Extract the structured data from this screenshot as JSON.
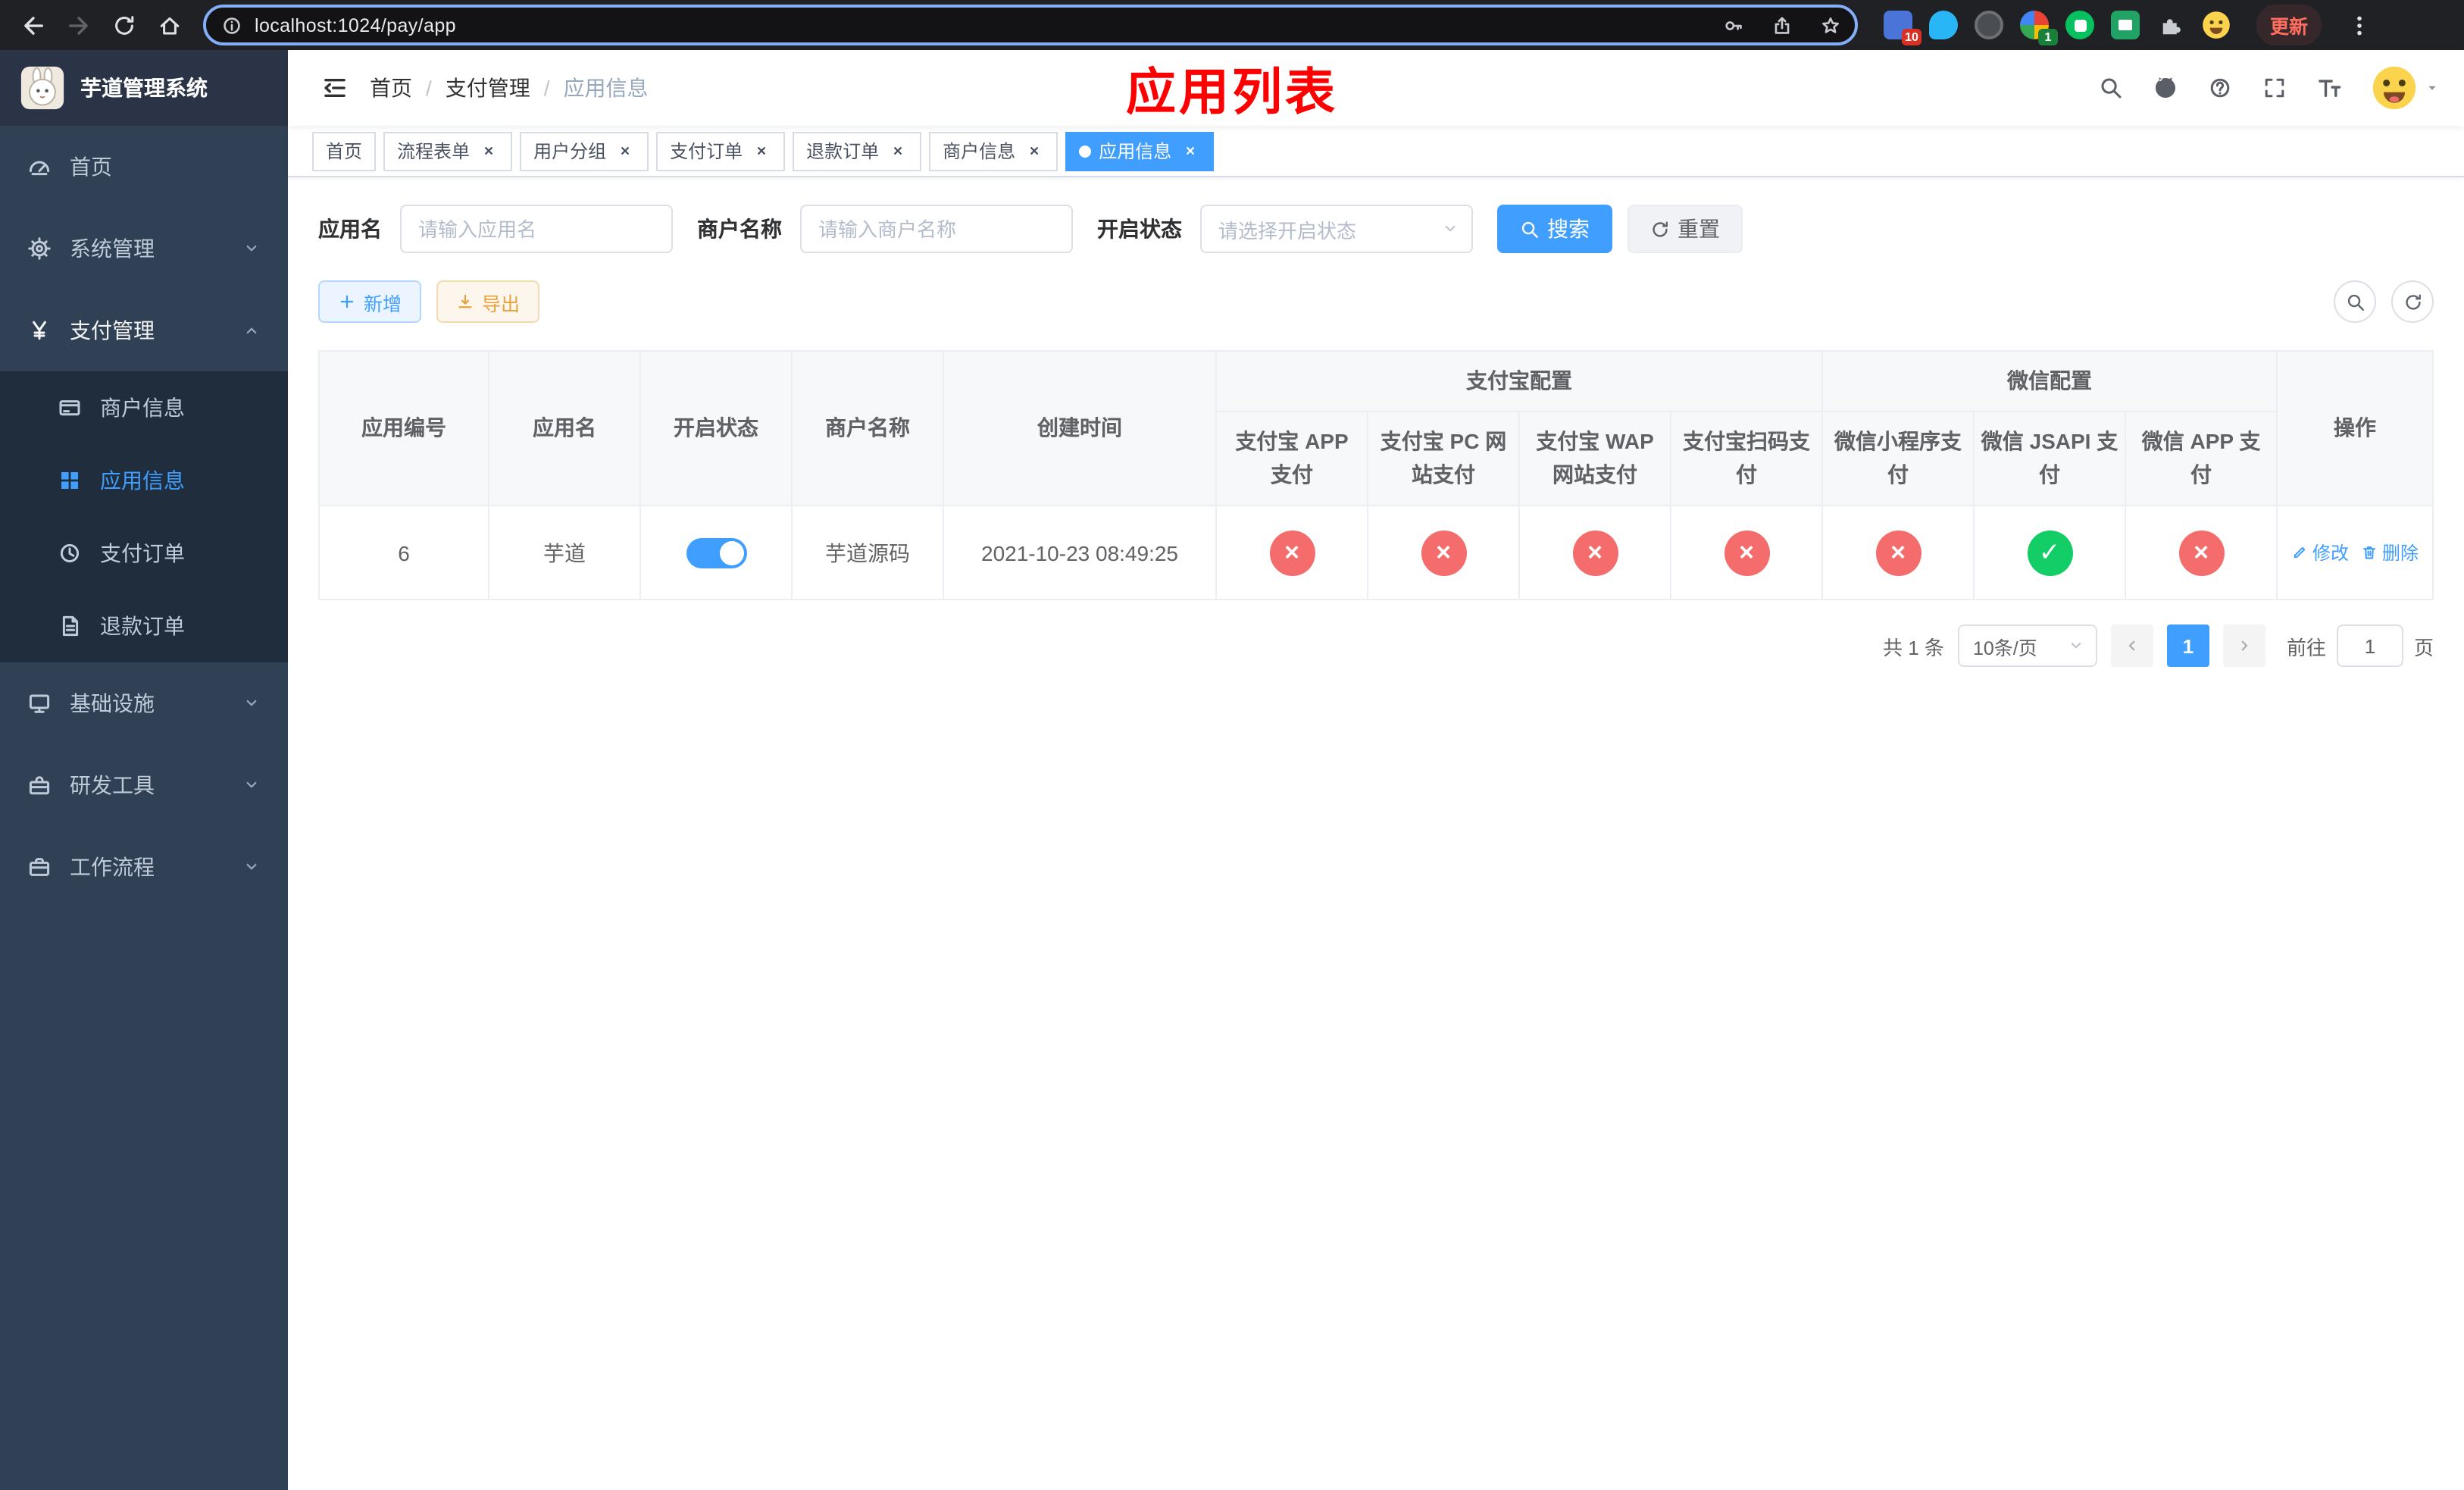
{
  "browser": {
    "url": "localhost:1024/pay/app",
    "update_label": "更新",
    "ext_badge_red": "10",
    "ext_badge_green": "1"
  },
  "sidebar": {
    "title": "芋道管理系统",
    "items": {
      "home": "首页",
      "system": "系统管理",
      "payment": "支付管理",
      "merchant_info": "商户信息",
      "app_info": "应用信息",
      "pay_order": "支付订单",
      "refund_order": "退款订单",
      "infra": "基础设施",
      "dev_tools": "研发工具",
      "workflow": "工作流程"
    }
  },
  "navbar": {
    "breadcrumb": {
      "home": "首页",
      "sep": "/",
      "section": "支付管理",
      "current": "应用信息"
    },
    "overlay_title": "应用列表"
  },
  "tabs": [
    {
      "label": "首页",
      "closable": false,
      "active": false
    },
    {
      "label": "流程表单",
      "closable": true,
      "active": false
    },
    {
      "label": "用户分组",
      "closable": true,
      "active": false
    },
    {
      "label": "支付订单",
      "closable": true,
      "active": false
    },
    {
      "label": "退款订单",
      "closable": true,
      "active": false
    },
    {
      "label": "商户信息",
      "closable": true,
      "active": false
    },
    {
      "label": "应用信息",
      "closable": true,
      "active": true
    }
  ],
  "filters": {
    "app_name": {
      "label": "应用名",
      "placeholder": "请输入应用名",
      "value": ""
    },
    "merchant_name": {
      "label": "商户名称",
      "placeholder": "请输入商户名称",
      "value": ""
    },
    "status": {
      "label": "开启状态",
      "placeholder": "请选择开启状态"
    },
    "search": "搜索",
    "reset": "重置"
  },
  "toolbar": {
    "add": "新增",
    "export": "导出"
  },
  "table": {
    "columns": {
      "app_id": "应用编号",
      "app_name": "应用名",
      "status": "开启状态",
      "merchant": "商户名称",
      "created": "创建时间",
      "alipay_group": "支付宝配置",
      "wechat_group": "微信配置",
      "actions": "操作",
      "alipay_children": [
        "支付宝 APP 支付",
        "支付宝 PC 网站支付",
        "支付宝 WAP 网站支付",
        "支付宝扫码支付"
      ],
      "wechat_children": [
        "微信小程序支付",
        "微信 JSAPI 支付",
        "微信 APP 支付"
      ]
    },
    "rows": [
      {
        "app_id": "6",
        "app_name": "芋道",
        "enabled": true,
        "merchant": "芋道源码",
        "created": "2021-10-23 08:49:25",
        "configs": [
          "disabled",
          "disabled",
          "disabled",
          "disabled",
          "disabled",
          "enabled",
          "disabled"
        ],
        "edit": "修改",
        "delete": "删除"
      }
    ]
  },
  "pagination": {
    "total": "共 1 条",
    "page_size": "10条/页",
    "page": "1",
    "goto_label": "前往",
    "goto_value": "1",
    "goto_unit": "页"
  },
  "icons": {
    "enabled_glyph": "✓",
    "disabled_glyph": "×"
  },
  "colors": {
    "primary": "#409eff",
    "danger": "#f56c6c",
    "success": "#13ce66",
    "warning": "#e6a23c",
    "annotation_red": "#fe0000"
  }
}
